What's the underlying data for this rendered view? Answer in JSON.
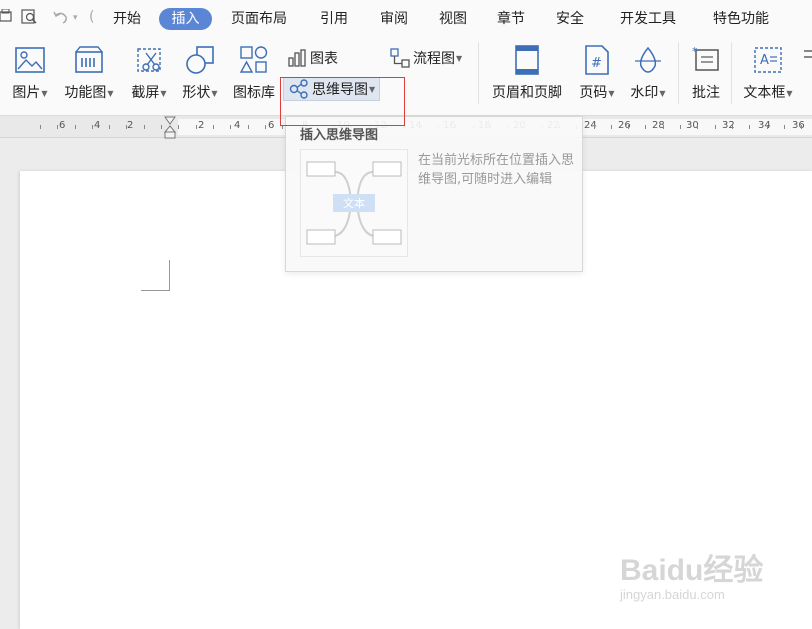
{
  "tabs": [
    {
      "label": "开始",
      "active": false
    },
    {
      "label": "插入",
      "active": true
    },
    {
      "label": "页面布局",
      "active": false
    },
    {
      "label": "引用",
      "active": false
    },
    {
      "label": "审阅",
      "active": false
    },
    {
      "label": "视图",
      "active": false
    },
    {
      "label": "章节",
      "active": false
    },
    {
      "label": "安全",
      "active": false
    },
    {
      "label": "开发工具",
      "active": false
    },
    {
      "label": "特色功能",
      "active": false
    }
  ],
  "ribbon": {
    "picture": "图片",
    "function_chart": "功能图",
    "screenshot": "截屏",
    "shape": "形状",
    "icon_library": "图标库",
    "chart": "图表",
    "flowchart": "流程图",
    "mindmap": "思维导图",
    "header_footer": "页眉和页脚",
    "page_number": "页码",
    "watermark": "水印",
    "comment": "批注",
    "textbox": "文本框"
  },
  "ruler": {
    "labels": [
      "6",
      "4",
      "2",
      "2",
      "4",
      "6",
      "8",
      "10",
      "12",
      "14",
      "16",
      "18",
      "20",
      "22",
      "24",
      "26",
      "28",
      "30",
      "32",
      "34",
      "36"
    ]
  },
  "tooltip": {
    "title": "插入思维导图",
    "preview_center": "文本",
    "description": "在当前光标所在位置插入思维导图,可随时进入编辑"
  },
  "watermark": {
    "logo": "Baidu经验",
    "url": "jingyan.baidu.com"
  },
  "colors": {
    "active_tab": "#5b86d6",
    "highlight_box": "#e03c3c",
    "icon_blue": "#3d6fb6"
  }
}
